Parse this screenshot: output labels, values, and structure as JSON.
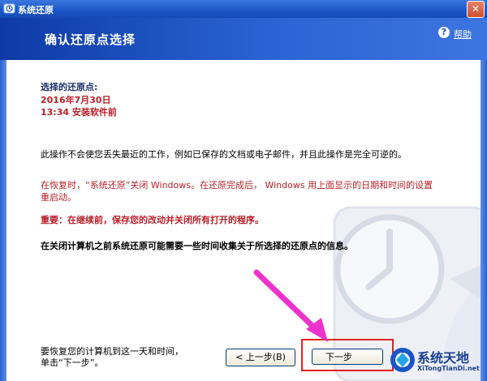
{
  "window": {
    "title": "系统还原",
    "close_glyph": "✕"
  },
  "header": {
    "title": "确认还原点选择",
    "help_label": "帮助",
    "help_glyph": "?"
  },
  "restore_point": {
    "label": "选择的还原点:",
    "date": "2016年7月30日",
    "time_desc": "13:34 安装软件前"
  },
  "body": {
    "paragraph1": "此操作不会使您丢失最近的工作，例如已保存的文档或电子邮件，并且此操作是完全可逆的。",
    "paragraph2_line1": "在恢复时，“系统还原”关闭 Windows。在还原完成后， Windows 用上面显示的日期和时间的设置",
    "paragraph2_line2": "重启动。",
    "paragraph3": "重要：在继续前，保存您的改动并关闭所有打开的程序。",
    "paragraph4": "在关闭计算机之前系统还原可能需要一些时间收集关于所选择的还原点的信息。"
  },
  "footer": {
    "hint_line1": "要恢复您的计算机到这一天和时间，",
    "hint_line2": "单击“下一步”。",
    "back_button": "< 上一步(B)",
    "next_button": "下一步"
  },
  "brand": {
    "name": "系统天地",
    "url": "XiTongTianDi.net"
  },
  "colors": {
    "header_dark": "#0d3aa6",
    "header_light": "#3d75e0",
    "warning_red": "#b8202a",
    "label_navy": "#1b2f6b",
    "highlight_red": "#e02222",
    "annotation_magenta": "#ee33cc"
  }
}
